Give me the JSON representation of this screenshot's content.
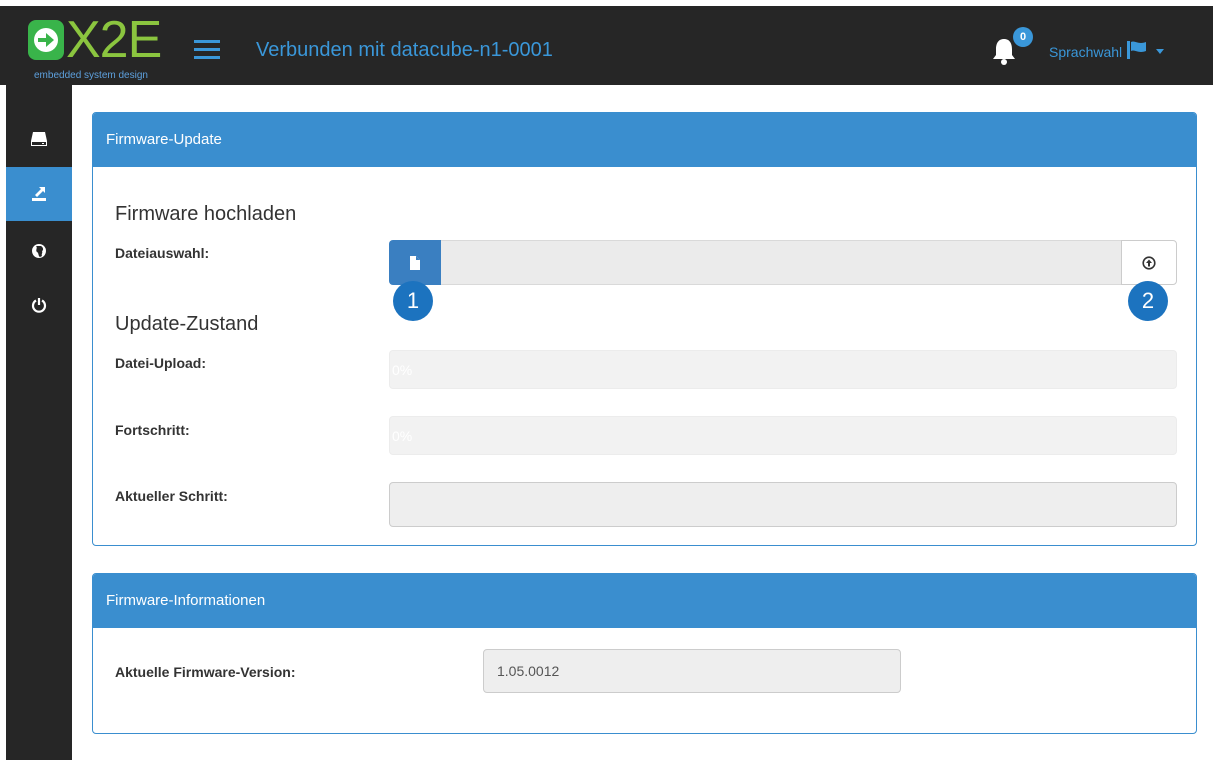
{
  "header": {
    "logo_text": "X2E",
    "logo_tagline": "embedded system design",
    "connection_title": "Verbunden mit datacube-n1-0001",
    "notification_count": "0",
    "language_label": "Sprachwahl"
  },
  "sidebar": {
    "items": [
      {
        "icon": "drive-icon",
        "active": false
      },
      {
        "icon": "firmware-upload-icon",
        "active": true
      },
      {
        "icon": "globe-icon",
        "active": false
      },
      {
        "icon": "power-icon",
        "active": false
      }
    ]
  },
  "firmware_update": {
    "panel_title": "Firmware-Update",
    "upload_section_title": "Firmware hochladen",
    "file_select_label": "Dateiauswahl:",
    "marker_file": "1",
    "marker_upload": "2",
    "status_section_title": "Update-Zustand",
    "file_upload_label": "Datei-Upload:",
    "file_upload_progress": "0%",
    "progress_label": "Fortschritt:",
    "progress_value": "0%",
    "current_step_label": "Aktueller Schritt:",
    "current_step_value": ""
  },
  "firmware_info": {
    "panel_title": "Firmware-Informationen",
    "version_label": "Aktuelle Firmware-Version:",
    "version_value": "1.05.0012"
  },
  "colors": {
    "accent": "#3a8ecf",
    "topbar": "#262626",
    "logo_green": "#8bc53f",
    "marker": "#1c73bf"
  }
}
